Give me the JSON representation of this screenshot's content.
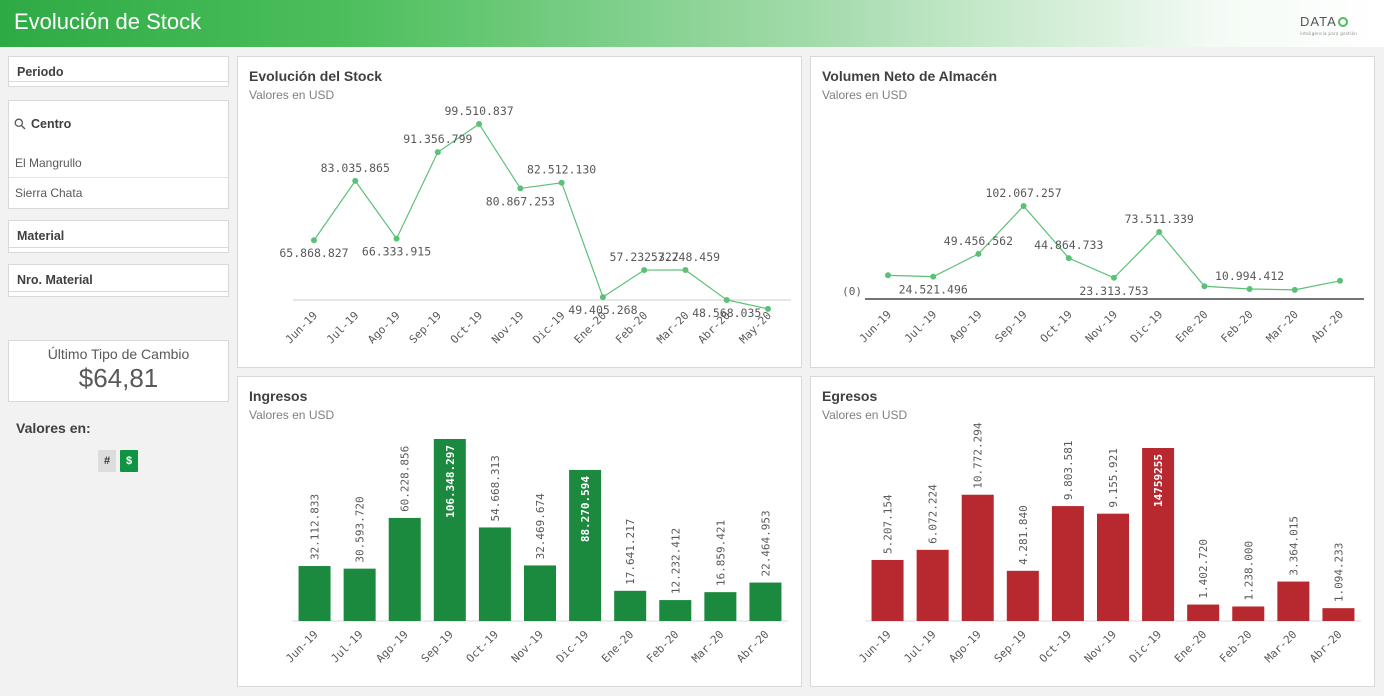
{
  "header": {
    "title": "Evolución de Stock",
    "logo_text": "DATA",
    "logo_sub": "inteligencia para gestión"
  },
  "filters": {
    "periodo": {
      "label": "Periodo"
    },
    "centro": {
      "label": "Centro",
      "items": [
        "El Mangrullo",
        "Sierra Chata"
      ]
    },
    "material": {
      "label": "Material"
    },
    "nro_material": {
      "label": "Nro. Material"
    }
  },
  "kpi": {
    "label": "Último Tipo de Cambio",
    "value": "$64,81"
  },
  "valores": {
    "label": "Valores en:",
    "options": [
      "#",
      "$"
    ],
    "selected": "$"
  },
  "colors": {
    "line": "#5ac178",
    "green_bar": "#1b8a3e",
    "red_bar": "#b8282f",
    "header_start": "#2eaa44"
  },
  "chart_data": [
    {
      "id": "stock",
      "type": "line",
      "title": "Evolución del Stock",
      "subtitle": "Valores en USD",
      "categories": [
        "Jun-19",
        "Jul-19",
        "Ago-19",
        "Sep-19",
        "Oct-19",
        "Nov-19",
        "Dic-19",
        "Ene-20",
        "Feb-20",
        "Mar-20",
        "Abr-20",
        "May-20"
      ],
      "values": [
        65868827,
        83035865,
        66333915,
        91356799,
        99510837,
        80867253,
        82512130,
        49405268,
        57232327,
        57248459,
        48568035,
        null
      ],
      "labels": [
        "65.868.827",
        "83.035.865",
        "66.333.915",
        "91.356.799",
        "99.510.837",
        "80.867.253",
        "82.512.130",
        "49.405.268",
        "57.232.327",
        "57.248.459",
        "48.568.035",
        ""
      ],
      "label_pos": [
        "below",
        "above",
        "below",
        "above",
        "above",
        "below",
        "above",
        "below",
        "above",
        "above",
        "below",
        "none"
      ]
    },
    {
      "id": "volumen",
      "type": "line",
      "title": "Volumen Neto de Almacén",
      "subtitle": "Valores en USD",
      "categories": [
        "Jun-19",
        "Jul-19",
        "Ago-19",
        "Sep-19",
        "Oct-19",
        "Nov-19",
        "Dic-19",
        "Ene-20",
        "Feb-20",
        "Mar-20",
        "Abr-20"
      ],
      "values": [
        null,
        24521496,
        49456562,
        102067257,
        44864733,
        23313753,
        73511339,
        null,
        10994412,
        null,
        null
      ],
      "labels": [
        "",
        "24.521.496",
        "49.456.562",
        "102.067.257",
        "44.864.733",
        "23.313.753",
        "73.511.339",
        "",
        "10.994.412",
        "",
        ""
      ],
      "label_pos": [
        "none",
        "below",
        "above",
        "above",
        "above",
        "below",
        "above",
        "none",
        "above",
        "none",
        "none"
      ],
      "zero_label": "(0)"
    },
    {
      "id": "ingresos",
      "type": "bar",
      "title": "Ingresos",
      "subtitle": "Valores en USD",
      "color": "#1b8a3e",
      "categories": [
        "Jun-19",
        "Jul-19",
        "Ago-19",
        "Sep-19",
        "Oct-19",
        "Nov-19",
        "Dic-19",
        "Ene-20",
        "Feb-20",
        "Mar-20",
        "Abr-20"
      ],
      "values": [
        32112833,
        30593720,
        60228856,
        106348297,
        54668313,
        32469674,
        88270594,
        17641217,
        12232412,
        16859421,
        22464953
      ],
      "labels": [
        "32.112.833",
        "30.593.720",
        "60.228.856",
        "106.348.297",
        "54.668.313",
        "32.469.674",
        "88.270.594",
        "17.641.217",
        "12.232.412",
        "16.859.421",
        "22.464.953"
      ],
      "ylim": [
        0,
        106348297
      ]
    },
    {
      "id": "egresos",
      "type": "bar",
      "title": "Egresos",
      "subtitle": "Valores en USD",
      "color": "#b8282f",
      "categories": [
        "Jun-19",
        "Jul-19",
        "Ago-19",
        "Sep-19",
        "Oct-19",
        "Nov-19",
        "Dic-19",
        "Ene-20",
        "Feb-20",
        "Mar-20",
        "Abr-20"
      ],
      "values": [
        5207154,
        6072224,
        10772294,
        4281840,
        9803581,
        9155921,
        14759255,
        1402720,
        1238000,
        3364015,
        1094233
      ],
      "labels": [
        "5.207.154",
        "6.072.224",
        "10.772.294",
        "4.281.840",
        "9.803.581",
        "9.155.921",
        "14759255",
        "1.402.720",
        "1.238.000",
        "3.364.015",
        "1.094.233"
      ],
      "ylim": [
        0,
        14759255
      ]
    }
  ]
}
